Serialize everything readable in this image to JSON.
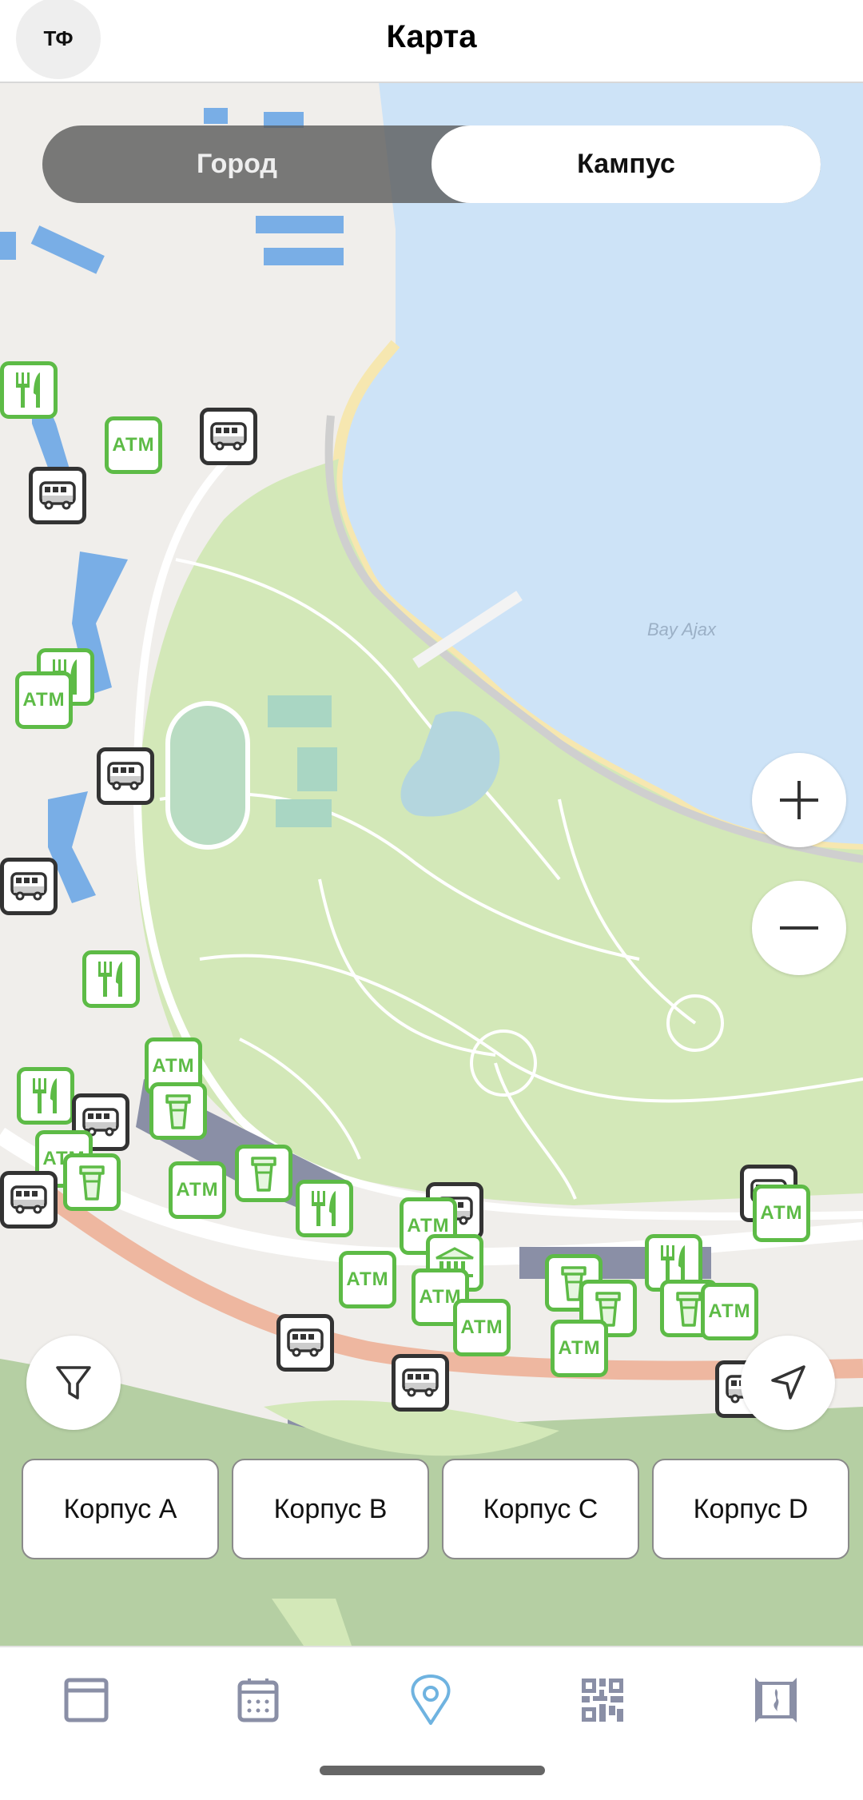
{
  "header": {
    "avatar_initials": "ТФ",
    "title": "Карта"
  },
  "map_mode_toggle": {
    "options": [
      "Город",
      "Кампус"
    ],
    "selected": "Кампус"
  },
  "map": {
    "water_label": "Bay Ajax",
    "atm_label": "ATM",
    "colors": {
      "water": "#cde3f7",
      "park": "#d3e8b8",
      "land": "#f0eeeb",
      "main_road": "#eeb7a0",
      "buildings": "#8a8fa6",
      "poi_green": "#5dbb46",
      "poi_transport": "#333333"
    },
    "marker_types": [
      "atm",
      "bus",
      "food",
      "coffee",
      "bank"
    ]
  },
  "controls": {
    "zoom_in": "plus-icon",
    "zoom_out": "minus-icon",
    "filter": "filter-icon",
    "locate": "navigation-arrow-icon"
  },
  "buildings": [
    {
      "label": "Корпус A"
    },
    {
      "label": "Корпус B"
    },
    {
      "label": "Корпус C"
    },
    {
      "label": "Корпус D"
    }
  ],
  "bottom_nav": {
    "items": [
      {
        "icon": "news-icon",
        "active": false
      },
      {
        "icon": "calendar-icon",
        "active": false
      },
      {
        "icon": "map-pin-icon",
        "active": true
      },
      {
        "icon": "qr-code-icon",
        "active": false
      },
      {
        "icon": "pass-card-icon",
        "active": false
      }
    ],
    "active_color": "#6fb3e0",
    "inactive_color": "#8a8fa6"
  }
}
